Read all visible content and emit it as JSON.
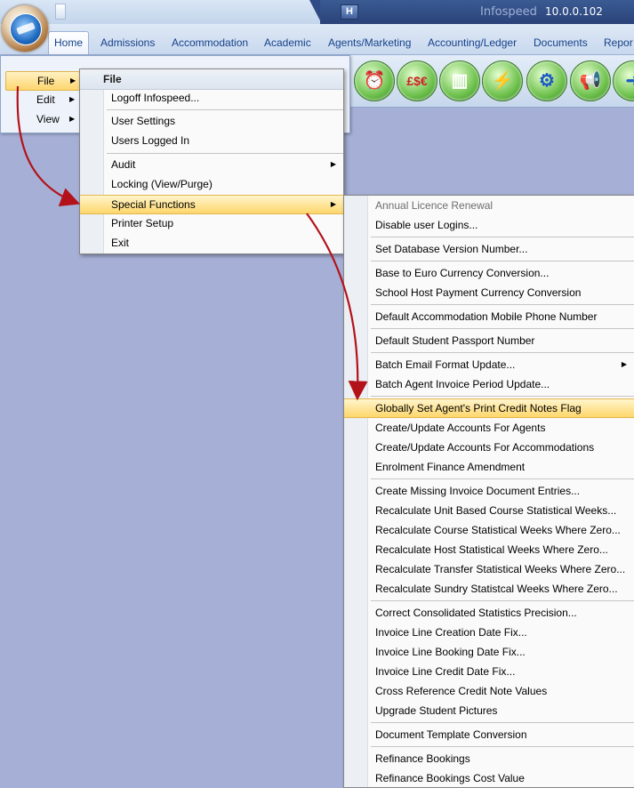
{
  "titlebar": {
    "quick_button": "H",
    "app_title": "Infospeed",
    "server_ip": "10.0.0.102"
  },
  "tabs": [
    "Home",
    "Admissions",
    "Accommodation",
    "Academic",
    "Agents/Marketing",
    "Accounting/Ledger",
    "Documents",
    "Repor"
  ],
  "ribbon_icons": [
    "alarm-clock-icon",
    "currency-icon",
    "columns-icon",
    "lightning-icon",
    "gears-icon",
    "megaphone-icon",
    "arrow-icon"
  ],
  "app_menu": {
    "items": [
      {
        "label": "File",
        "active": true
      },
      {
        "label": "Edit",
        "active": false
      },
      {
        "label": "View",
        "active": false
      }
    ]
  },
  "file_menu": {
    "header": "File",
    "items": {
      "logoff": "Logoff Infospeed...",
      "user_settings": "User Settings",
      "users_logged_in": "Users Logged In",
      "audit": "Audit",
      "locking": "Locking (View/Purge)",
      "special_functions": "Special Functions",
      "printer_setup": "Printer Setup",
      "exit": "Exit"
    }
  },
  "special_menu": {
    "items": [
      "Annual Licence Renewal",
      "Disable user Logins...",
      "Set Database Version Number...",
      "Base to Euro Currency Conversion...",
      "School Host Payment Currency Conversion",
      "Default Accommodation Mobile Phone Number",
      "Default Student Passport Number",
      "Batch Email Format Update...",
      "Batch Agent Invoice Period Update...",
      "Globally Set Agent's Print Credit Notes Flag",
      "Create/Update Accounts For Agents",
      "Create/Update Accounts For Accommodations",
      "Enrolment Finance Amendment",
      "Create Missing Invoice Document Entries...",
      "Recalculate Unit Based Course Statistical Weeks...",
      "Recalculate Course Statistical Weeks Where Zero...",
      "Recalculate Host Statistical Weeks Where Zero...",
      "Recalculate Transfer Statistical Weeks Where Zero...",
      "Recalculate Sundry Statistcal Weeks Where Zero...",
      "Correct  Consolidated Statistics  Precision...",
      "Invoice Line Creation Date Fix...",
      "Invoice Line Booking Date Fix...",
      "Invoice Line Credit Date Fix...",
      "Cross Reference Credit Note Values",
      "Upgrade Student Pictures",
      "Document Template Conversion",
      "Refinance Bookings",
      "Refinance Bookings Cost Value"
    ]
  },
  "colors": {
    "background": "#a6afd6",
    "highlight": "#fed66b",
    "annotation_arrow": "#b3121a",
    "tab_text": "#15428b"
  }
}
